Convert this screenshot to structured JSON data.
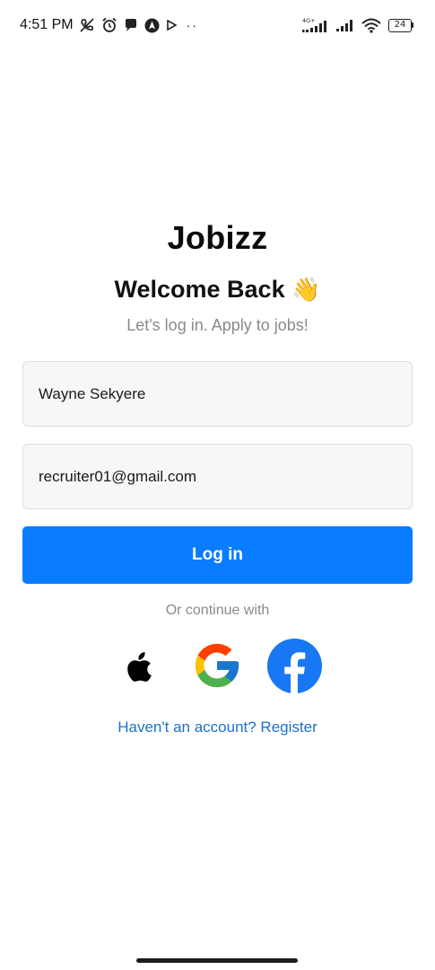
{
  "status_bar": {
    "time": "4:51 PM",
    "icons_left": [
      "call-muted-icon",
      "alarm-icon",
      "chat-bubble-icon",
      "navigation-icon",
      "play-store-icon"
    ],
    "dots": "··",
    "network_label": "4G+",
    "battery": "24",
    "icons_right": [
      "signal-strength-icon",
      "wifi-icon",
      "battery-icon"
    ]
  },
  "app_title": "Jobizz",
  "welcome": {
    "text": "Welcome Back",
    "emoji": "👋"
  },
  "subtitle": "Let's log in. Apply to jobs!",
  "form": {
    "name_value": "Wayne Sekyere",
    "email_value": "recruiter01@gmail.com",
    "login_label": "Log in"
  },
  "or_text": "Or continue with",
  "social": [
    "apple-icon",
    "google-icon",
    "facebook-icon"
  ],
  "register_link": "Haven't an account? Register",
  "colors": {
    "primary": "#0a7cff",
    "link": "#1a73c8",
    "muted_text": "#8a8a8a",
    "field_bg": "#f7f7f7",
    "facebook": "#1877f2"
  }
}
